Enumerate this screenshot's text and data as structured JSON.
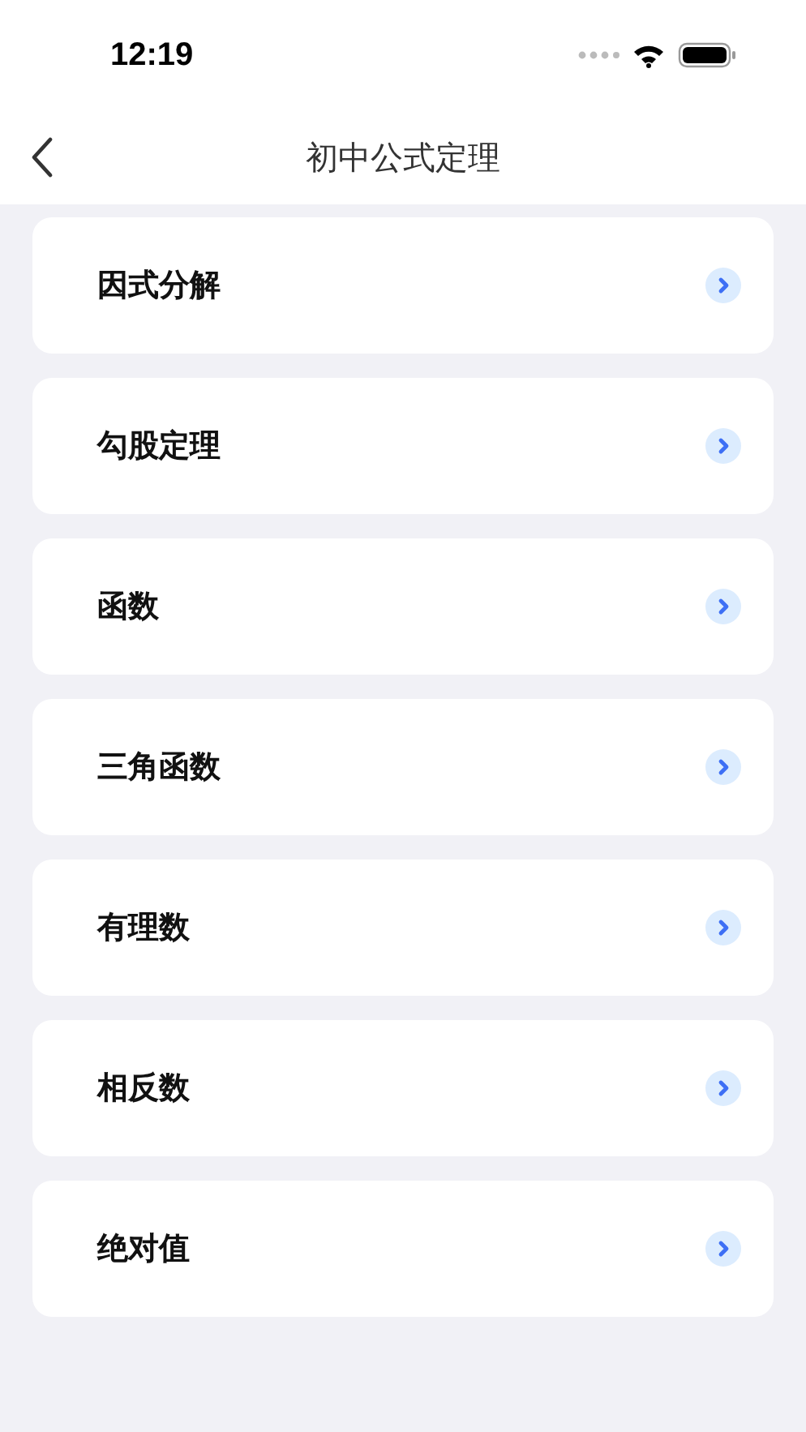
{
  "status_bar": {
    "time": "12:19"
  },
  "nav": {
    "title": "初中公式定理"
  },
  "items": [
    {
      "label": "因式分解"
    },
    {
      "label": "勾股定理"
    },
    {
      "label": "函数"
    },
    {
      "label": "三角函数"
    },
    {
      "label": "有理数"
    },
    {
      "label": "相反数"
    },
    {
      "label": "绝对值"
    }
  ]
}
